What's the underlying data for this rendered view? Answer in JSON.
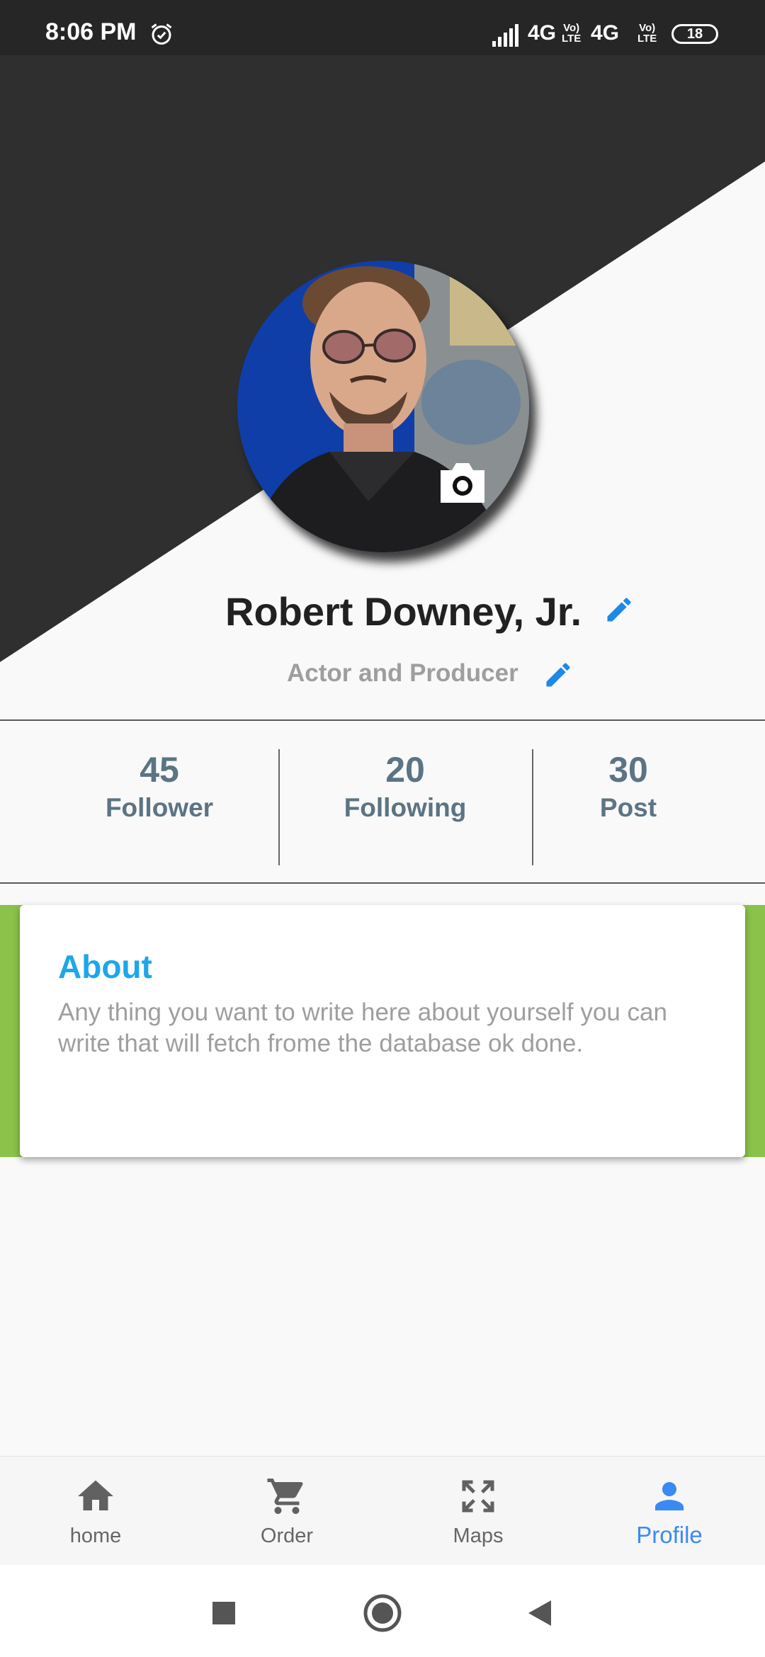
{
  "status_bar": {
    "time": "8:06 PM",
    "network1": "4G",
    "volte1_top": "Vo)",
    "volte1_bottom": "LTE",
    "network2": "4G",
    "volte2_top": "Vo)",
    "volte2_bottom": "LTE",
    "battery": "18",
    "icons": [
      "alarm-icon",
      "signal-icon"
    ]
  },
  "profile": {
    "name": "Robert Downey, Jr.",
    "role": "Actor and Producer",
    "icons": [
      "camera-icon",
      "edit-icon"
    ]
  },
  "stats": [
    {
      "value": "45",
      "label": "Follower"
    },
    {
      "value": "20",
      "label": "Following"
    },
    {
      "value": "30",
      "label": "Post"
    }
  ],
  "about": {
    "title": "About",
    "text": "Any thing you want to write here about yourself you can write that will fetch frome the database ok done."
  },
  "bottom_nav": [
    {
      "label": "home",
      "icon": "home-icon",
      "active": false
    },
    {
      "label": "Order",
      "icon": "cart-icon",
      "active": false
    },
    {
      "label": "Maps",
      "icon": "fullscreen-icon",
      "active": false
    },
    {
      "label": "Profile",
      "icon": "person-icon",
      "active": true
    }
  ],
  "colors": {
    "header_dark": "#2f2f2f",
    "accent_blue": "#1e88e5",
    "about_title": "#1ea6ea",
    "about_band": "#8bc34a",
    "stat_text": "#5c7483",
    "nav_active": "#3b8af1"
  }
}
